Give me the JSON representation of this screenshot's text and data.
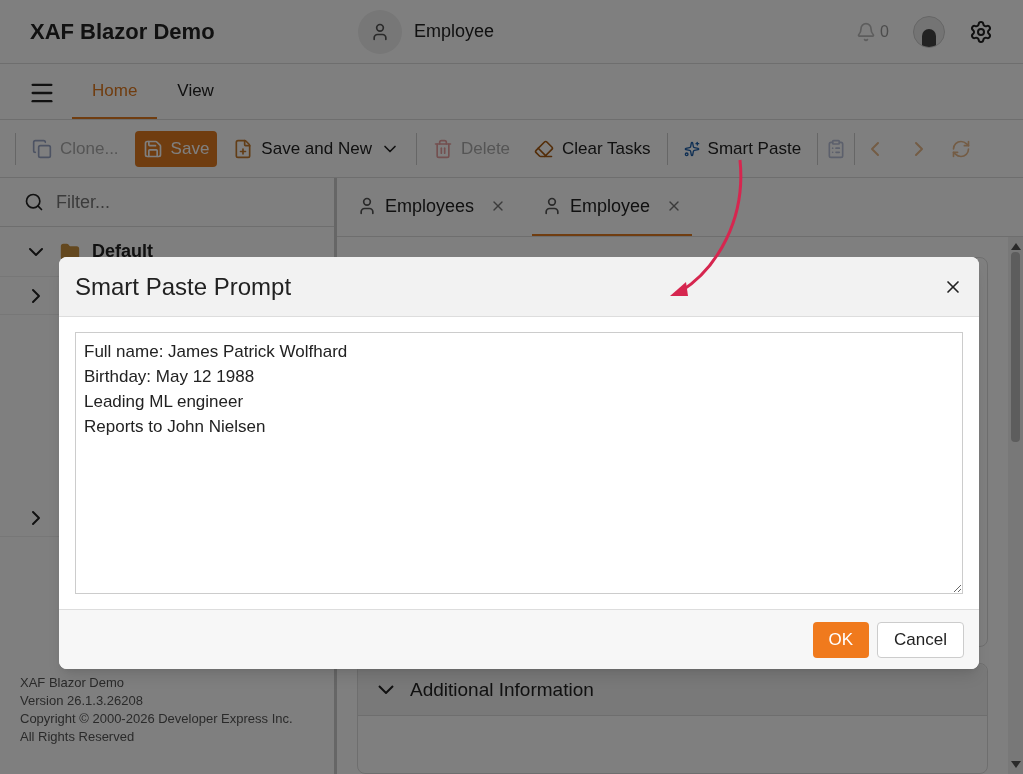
{
  "header": {
    "title": "XAF Blazor Demo",
    "view_label": "Employee",
    "notification_count": "0"
  },
  "ribbon_tabs": [
    {
      "label": "Home",
      "selected": true
    },
    {
      "label": "View",
      "selected": false
    }
  ],
  "toolbar": [
    {
      "kind": "clone",
      "label": "Clone...",
      "disabled": true
    },
    {
      "kind": "save",
      "label": "Save",
      "disabled": false
    },
    {
      "kind": "save_new",
      "label": "Save and New",
      "disabled": false
    },
    {
      "kind": "delete",
      "label": "Delete",
      "disabled": true
    },
    {
      "kind": "clear",
      "label": "Clear Tasks",
      "disabled": false
    },
    {
      "kind": "smart",
      "label": "Smart Paste",
      "disabled": false
    }
  ],
  "sidebar": {
    "filter_placeholder": "Filter...",
    "items": [
      {
        "label": "Default",
        "expanded": true
      },
      {
        "expanded": false
      },
      {
        "expanded": false
      }
    ],
    "footer": [
      "XAF Blazor Demo",
      "Version 26.1.3.26208",
      "Copyright © 2000-2026 Developer Express Inc.",
      "All Rights Reserved"
    ]
  },
  "doc_tabs": [
    {
      "label": "Employees",
      "selected": false
    },
    {
      "label": "Employee",
      "selected": true
    }
  ],
  "sections": [
    {
      "title": "Additional Information",
      "expanded": true
    }
  ],
  "dialog": {
    "title": "Smart Paste Prompt",
    "text": "Full name: James Patrick Wolfhard\nBirthday: May 12 1988\nLeading ML engineer\nReports to John Nielsen",
    "buttons": [
      {
        "kind": "primary",
        "label": "OK"
      },
      {
        "kind": "secondary",
        "label": "Cancel"
      }
    ]
  }
}
